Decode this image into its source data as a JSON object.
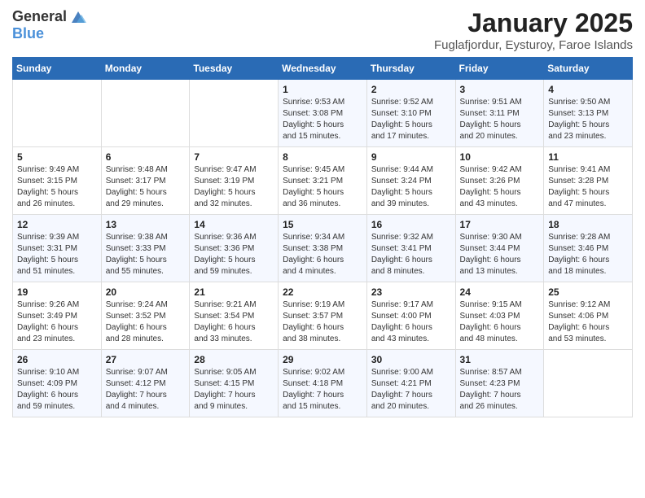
{
  "header": {
    "logo_general": "General",
    "logo_blue": "Blue",
    "title": "January 2025",
    "location": "Fuglafjordur, Eysturoy, Faroe Islands"
  },
  "weekdays": [
    "Sunday",
    "Monday",
    "Tuesday",
    "Wednesday",
    "Thursday",
    "Friday",
    "Saturday"
  ],
  "weeks": [
    [
      {
        "day": "",
        "info": ""
      },
      {
        "day": "",
        "info": ""
      },
      {
        "day": "",
        "info": ""
      },
      {
        "day": "1",
        "info": "Sunrise: 9:53 AM\nSunset: 3:08 PM\nDaylight: 5 hours\nand 15 minutes."
      },
      {
        "day": "2",
        "info": "Sunrise: 9:52 AM\nSunset: 3:10 PM\nDaylight: 5 hours\nand 17 minutes."
      },
      {
        "day": "3",
        "info": "Sunrise: 9:51 AM\nSunset: 3:11 PM\nDaylight: 5 hours\nand 20 minutes."
      },
      {
        "day": "4",
        "info": "Sunrise: 9:50 AM\nSunset: 3:13 PM\nDaylight: 5 hours\nand 23 minutes."
      }
    ],
    [
      {
        "day": "5",
        "info": "Sunrise: 9:49 AM\nSunset: 3:15 PM\nDaylight: 5 hours\nand 26 minutes."
      },
      {
        "day": "6",
        "info": "Sunrise: 9:48 AM\nSunset: 3:17 PM\nDaylight: 5 hours\nand 29 minutes."
      },
      {
        "day": "7",
        "info": "Sunrise: 9:47 AM\nSunset: 3:19 PM\nDaylight: 5 hours\nand 32 minutes."
      },
      {
        "day": "8",
        "info": "Sunrise: 9:45 AM\nSunset: 3:21 PM\nDaylight: 5 hours\nand 36 minutes."
      },
      {
        "day": "9",
        "info": "Sunrise: 9:44 AM\nSunset: 3:24 PM\nDaylight: 5 hours\nand 39 minutes."
      },
      {
        "day": "10",
        "info": "Sunrise: 9:42 AM\nSunset: 3:26 PM\nDaylight: 5 hours\nand 43 minutes."
      },
      {
        "day": "11",
        "info": "Sunrise: 9:41 AM\nSunset: 3:28 PM\nDaylight: 5 hours\nand 47 minutes."
      }
    ],
    [
      {
        "day": "12",
        "info": "Sunrise: 9:39 AM\nSunset: 3:31 PM\nDaylight: 5 hours\nand 51 minutes."
      },
      {
        "day": "13",
        "info": "Sunrise: 9:38 AM\nSunset: 3:33 PM\nDaylight: 5 hours\nand 55 minutes."
      },
      {
        "day": "14",
        "info": "Sunrise: 9:36 AM\nSunset: 3:36 PM\nDaylight: 5 hours\nand 59 minutes."
      },
      {
        "day": "15",
        "info": "Sunrise: 9:34 AM\nSunset: 3:38 PM\nDaylight: 6 hours\nand 4 minutes."
      },
      {
        "day": "16",
        "info": "Sunrise: 9:32 AM\nSunset: 3:41 PM\nDaylight: 6 hours\nand 8 minutes."
      },
      {
        "day": "17",
        "info": "Sunrise: 9:30 AM\nSunset: 3:44 PM\nDaylight: 6 hours\nand 13 minutes."
      },
      {
        "day": "18",
        "info": "Sunrise: 9:28 AM\nSunset: 3:46 PM\nDaylight: 6 hours\nand 18 minutes."
      }
    ],
    [
      {
        "day": "19",
        "info": "Sunrise: 9:26 AM\nSunset: 3:49 PM\nDaylight: 6 hours\nand 23 minutes."
      },
      {
        "day": "20",
        "info": "Sunrise: 9:24 AM\nSunset: 3:52 PM\nDaylight: 6 hours\nand 28 minutes."
      },
      {
        "day": "21",
        "info": "Sunrise: 9:21 AM\nSunset: 3:54 PM\nDaylight: 6 hours\nand 33 minutes."
      },
      {
        "day": "22",
        "info": "Sunrise: 9:19 AM\nSunset: 3:57 PM\nDaylight: 6 hours\nand 38 minutes."
      },
      {
        "day": "23",
        "info": "Sunrise: 9:17 AM\nSunset: 4:00 PM\nDaylight: 6 hours\nand 43 minutes."
      },
      {
        "day": "24",
        "info": "Sunrise: 9:15 AM\nSunset: 4:03 PM\nDaylight: 6 hours\nand 48 minutes."
      },
      {
        "day": "25",
        "info": "Sunrise: 9:12 AM\nSunset: 4:06 PM\nDaylight: 6 hours\nand 53 minutes."
      }
    ],
    [
      {
        "day": "26",
        "info": "Sunrise: 9:10 AM\nSunset: 4:09 PM\nDaylight: 6 hours\nand 59 minutes."
      },
      {
        "day": "27",
        "info": "Sunrise: 9:07 AM\nSunset: 4:12 PM\nDaylight: 7 hours\nand 4 minutes."
      },
      {
        "day": "28",
        "info": "Sunrise: 9:05 AM\nSunset: 4:15 PM\nDaylight: 7 hours\nand 9 minutes."
      },
      {
        "day": "29",
        "info": "Sunrise: 9:02 AM\nSunset: 4:18 PM\nDaylight: 7 hours\nand 15 minutes."
      },
      {
        "day": "30",
        "info": "Sunrise: 9:00 AM\nSunset: 4:21 PM\nDaylight: 7 hours\nand 20 minutes."
      },
      {
        "day": "31",
        "info": "Sunrise: 8:57 AM\nSunset: 4:23 PM\nDaylight: 7 hours\nand 26 minutes."
      },
      {
        "day": "",
        "info": ""
      }
    ]
  ]
}
